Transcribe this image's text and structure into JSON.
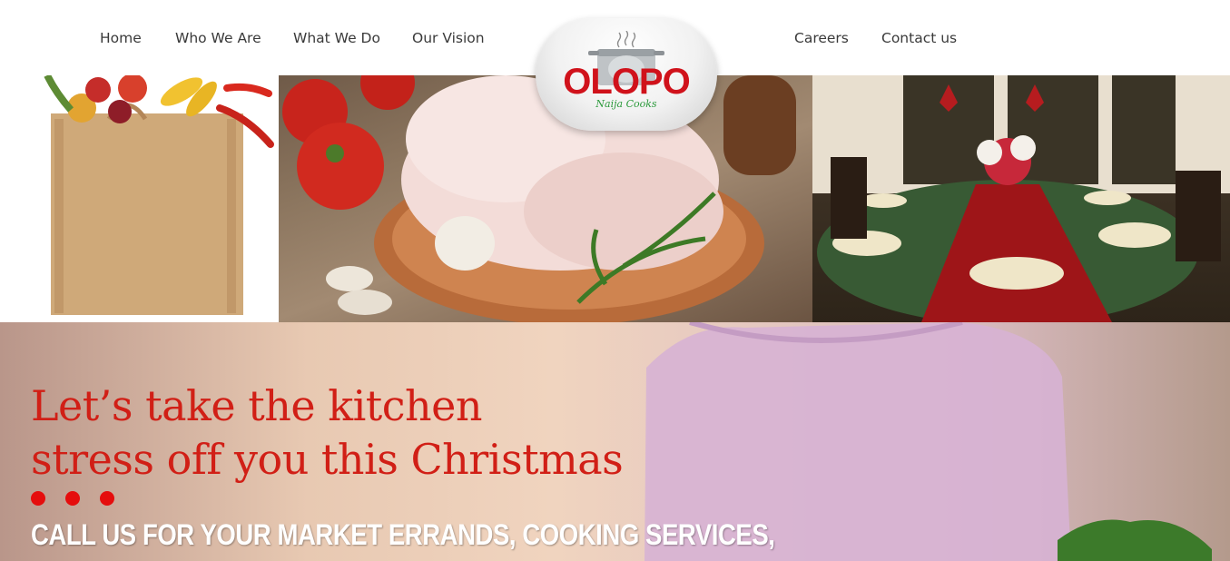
{
  "nav": {
    "left": [
      "Home",
      "Who We Are",
      "What We Do",
      "Our Vision"
    ],
    "right": [
      "Careers",
      "Contact us"
    ]
  },
  "logo": {
    "name": "OLOPO",
    "tagline": "Naija Cooks"
  },
  "hero": {
    "headline_line1": "Let’s take the kitchen",
    "headline_line2": "stress off you this Christmas",
    "subheadline": "CALL US FOR YOUR MARKET ERRANDS, COOKING SERVICES,"
  },
  "colors": {
    "headline": "#d11f16",
    "dots": "#e50d0d",
    "logo_red": "#d0121b",
    "logo_green": "#2c9a3c",
    "nav_text": "#3a3a3a"
  }
}
